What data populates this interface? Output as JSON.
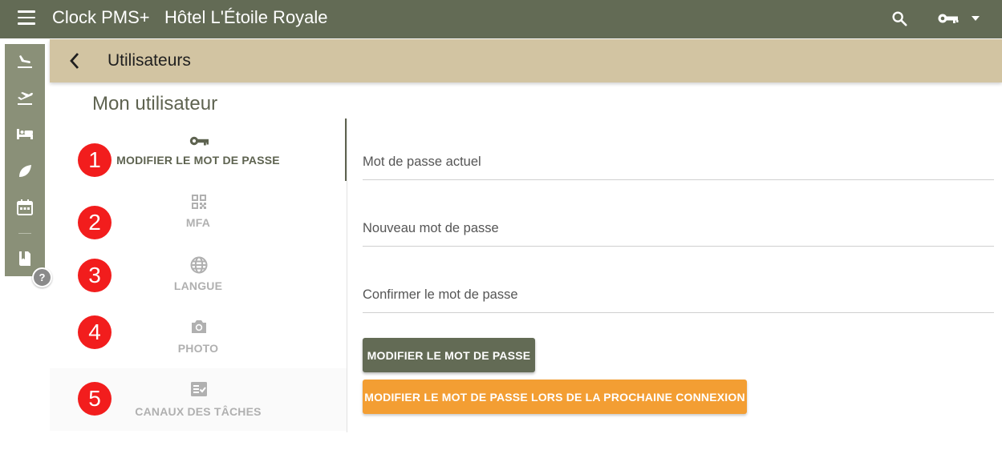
{
  "header": {
    "app_name": "Clock PMS+",
    "hotel_name": "Hôtel L'Étoile Royale",
    "icons": [
      "menu-icon",
      "search-icon",
      "key-icon",
      "chevron-down-icon"
    ]
  },
  "left_rail": {
    "items": [
      {
        "icon": "flight-land-icon"
      },
      {
        "icon": "flight-takeoff-icon"
      },
      {
        "icon": "hotel-bed-icon"
      },
      {
        "icon": "leaf-icon"
      },
      {
        "icon": "calendar-icon"
      },
      {
        "icon": "book-icon"
      }
    ],
    "help_label": "?"
  },
  "subheader": {
    "title": "Utilisateurs"
  },
  "page": {
    "section_title": "Mon utilisateur"
  },
  "tabs": [
    {
      "label": "MODIFIER LE MOT DE PASSE",
      "icon": "key-icon",
      "badge": "1",
      "active": true
    },
    {
      "label": "MFA",
      "icon": "qr-code-icon",
      "badge": "2",
      "active": false
    },
    {
      "label": "LANGUE",
      "icon": "globe-icon",
      "badge": "3",
      "active": false
    },
    {
      "label": "PHOTO",
      "icon": "camera-icon",
      "badge": "4",
      "active": false
    },
    {
      "label": "CANAUX DES TÂCHES",
      "icon": "task-list-icon",
      "badge": "5",
      "active": false
    }
  ],
  "form": {
    "fields": [
      {
        "label": "Mot de passe actuel"
      },
      {
        "label": "Nouveau mot de passe"
      },
      {
        "label": "Confirmer le mot de passe"
      }
    ],
    "submit_label": "MODIFIER LE MOT DE PASSE",
    "force_change_label": "MODIFIER LE MOT DE PASSE LORS DE LA PROCHAINE CONNEXION"
  },
  "colors": {
    "topbar": "#636b55",
    "subheader": "#d2c4a2",
    "rail": "#8a9078",
    "badge": "#f21d1d",
    "primary_button": "#636b55",
    "warning_button": "#f39e33"
  }
}
